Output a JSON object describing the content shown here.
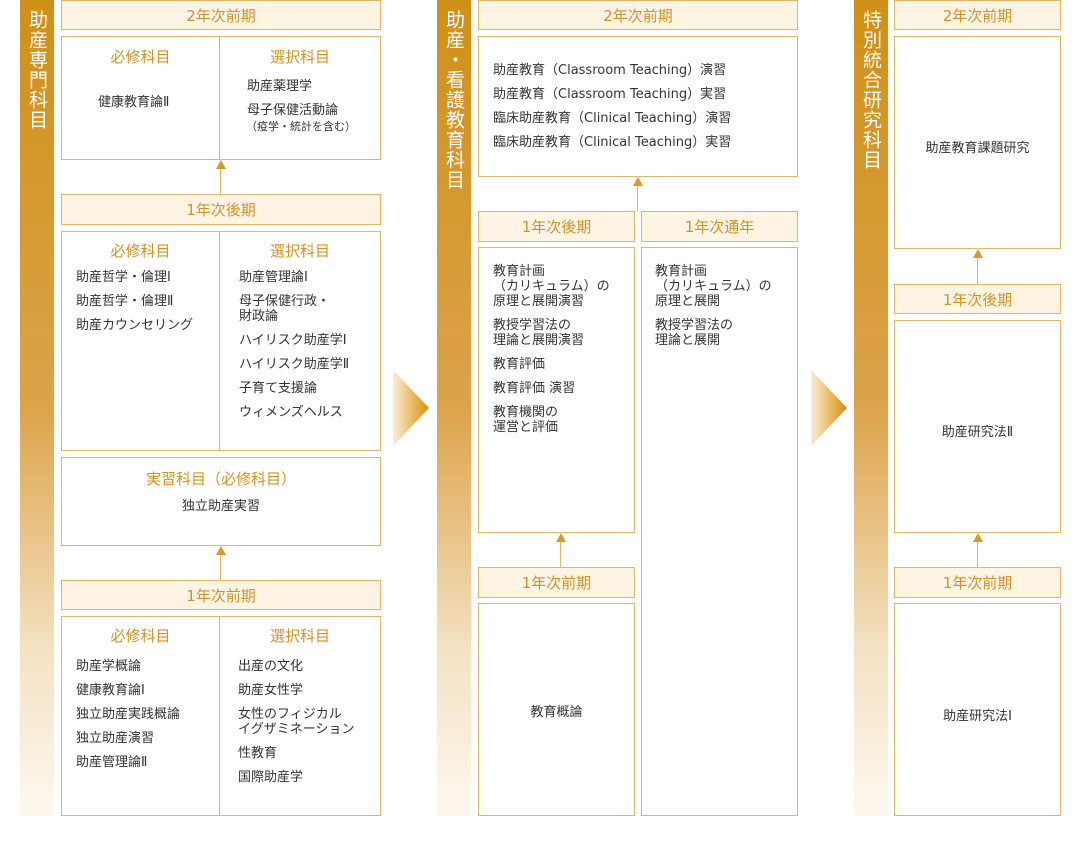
{
  "col1": {
    "title": "助産専門科目",
    "y2_first": {
      "header": "2年次前期",
      "required_title": "必修科目",
      "required": [
        "健康教育論Ⅱ"
      ],
      "elective_title": "選択科目",
      "elective": [
        "助産薬理学",
        "母子保健活動論"
      ],
      "elective_note": "（疫学・統計を含む）"
    },
    "y1_late": {
      "header": "1年次後期",
      "required_title": "必修科目",
      "required": [
        "助産哲学・倫理Ⅰ",
        "助産哲学・倫理Ⅱ",
        "助産カウンセリング"
      ],
      "elective_title": "選択科目",
      "elective": [
        "助産管理論Ⅰ",
        "母子保健行政・\n財政論",
        "ハイリスク助産学Ⅰ",
        "ハイリスク助産学Ⅱ",
        "子育て支援論",
        "ウィメンズヘルス"
      ]
    },
    "practice": {
      "title": "実習科目（必修科目）",
      "item": "独立助産実習"
    },
    "y1_early": {
      "header": "1年次前期",
      "required_title": "必修科目",
      "required": [
        "助産学概論",
        "健康教育論Ⅰ",
        "独立助産実践概論",
        "独立助産演習",
        "助産管理論Ⅱ"
      ],
      "elective_title": "選択科目",
      "elective": [
        "出産の文化",
        "助産女性学",
        "女性のフィジカル\nイグザミネーション",
        "性教育",
        "国際助産学"
      ]
    }
  },
  "col2": {
    "title": "助産・看護教育科目",
    "y2_first": {
      "header": "2年次前期",
      "items": [
        "助産教育（Classroom Teaching）演習",
        "助産教育（Classroom Teaching）実習",
        "臨床助産教育（Clinical Teaching）演習",
        "臨床助産教育（Clinical Teaching）実習"
      ]
    },
    "y1_late": {
      "header": "1年次後期",
      "items": [
        "教育計画\n（カリキュラム）の\n原理と展開演習",
        "教授学習法の\n理論と展開演習",
        "教育評価",
        "教育評価 演習",
        "教育機関の\n運営と評価"
      ]
    },
    "y1_full": {
      "header": "1年次通年",
      "items": [
        "教育計画\n（カリキュラム）の\n原理と展開",
        "教授学習法の\n理論と展開"
      ]
    },
    "y1_early": {
      "header": "1年次前期",
      "item": "教育概論"
    }
  },
  "col3": {
    "title": "特別統合研究科目",
    "y2_first": {
      "header": "2年次前期",
      "item": "助産教育課題研究"
    },
    "y1_late": {
      "header": "1年次後期",
      "item": "助産研究法Ⅱ"
    },
    "y1_early": {
      "header": "1年次前期",
      "item": "助産研究法Ⅰ"
    }
  },
  "colors": {
    "accent": "#d39128",
    "border": "#e2b56a",
    "header_bg": "#fdf4e3"
  }
}
